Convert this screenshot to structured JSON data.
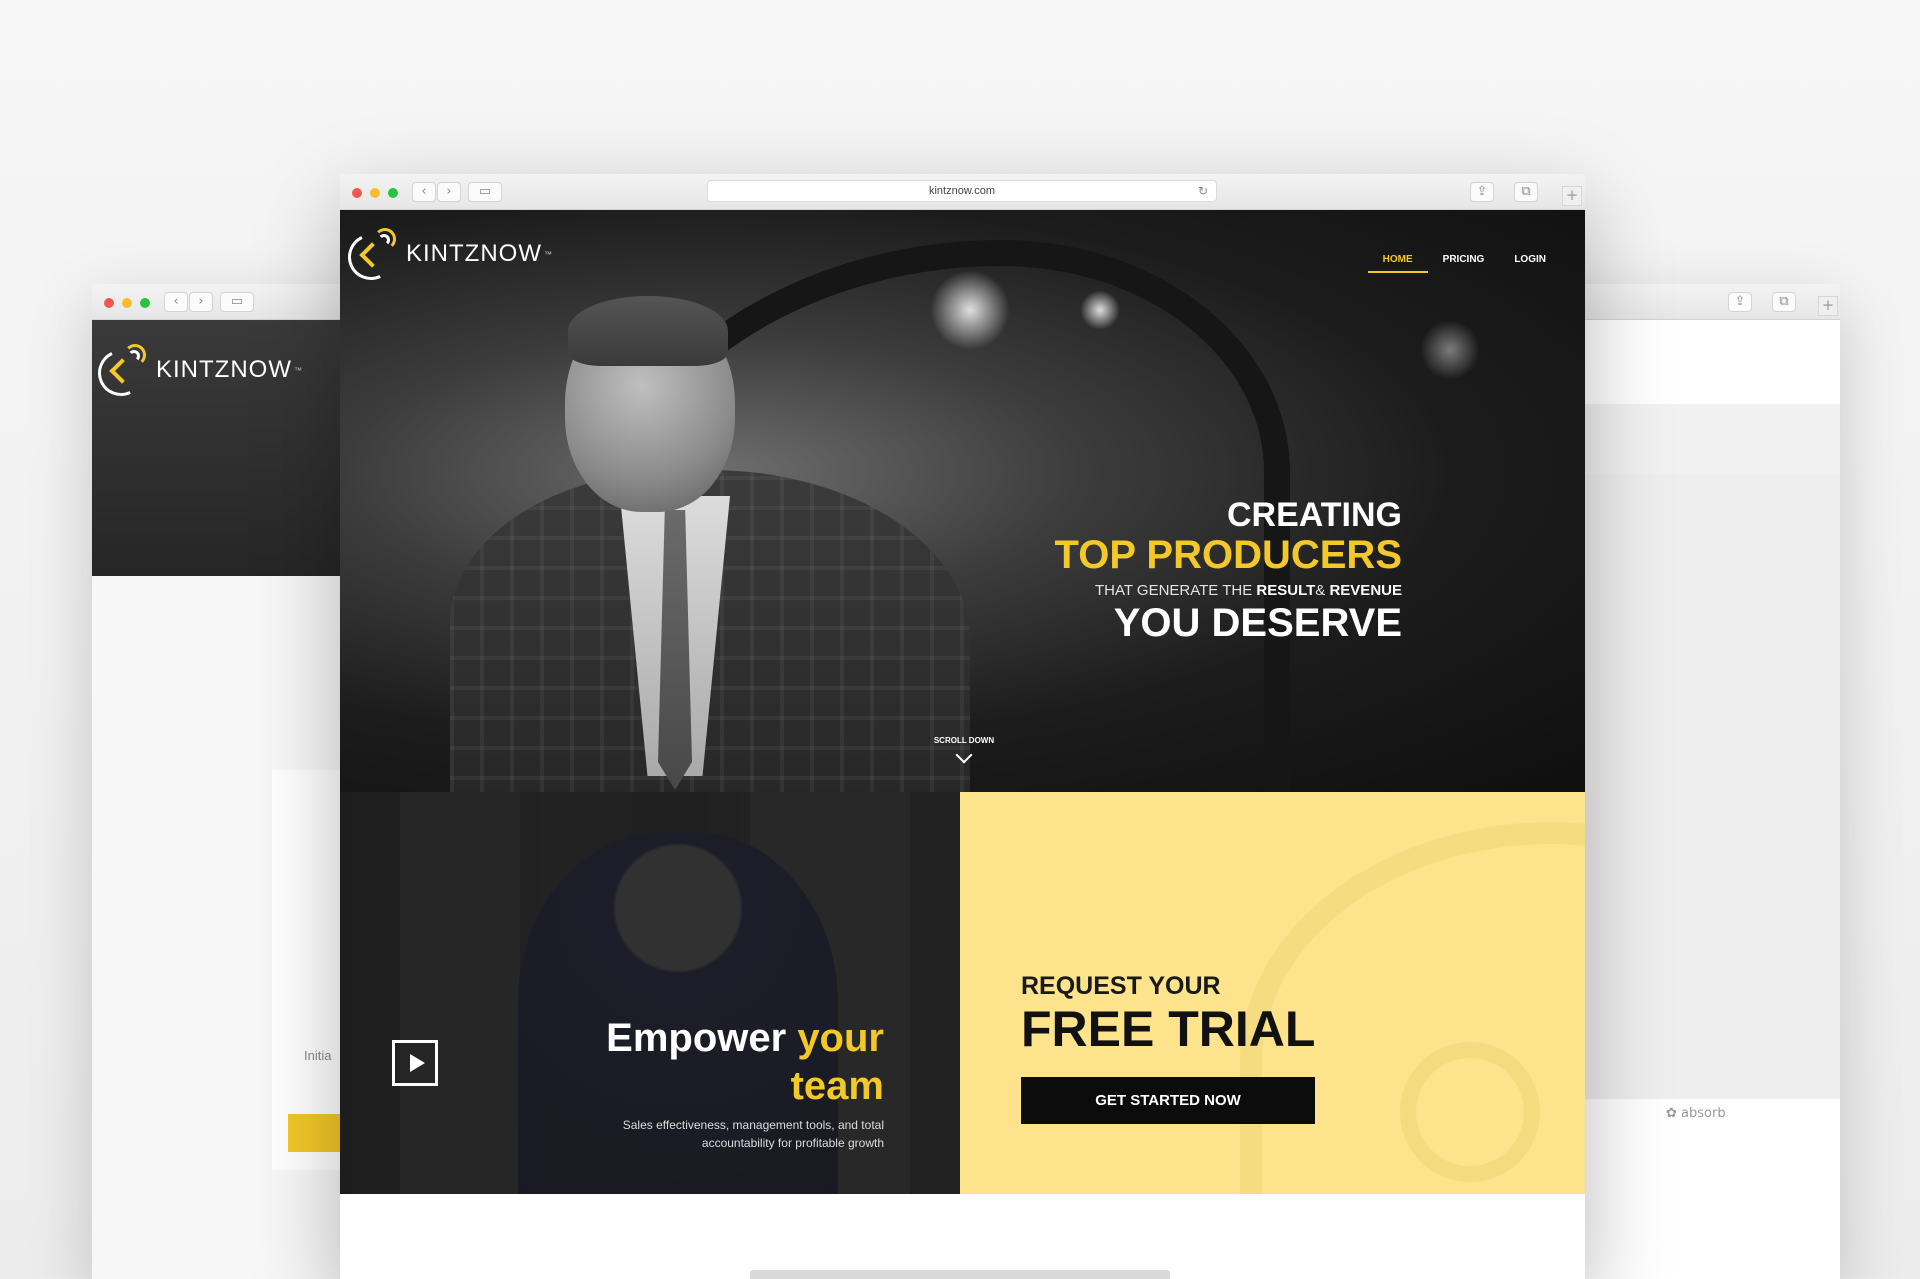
{
  "main_window": {
    "url": "kintznow.com",
    "logo_text": "KINTZNOW",
    "logo_tm": "™",
    "nav": [
      {
        "label": "HOME",
        "active": true
      },
      {
        "label": "PRICING",
        "active": false
      },
      {
        "label": "LOGIN",
        "active": false
      }
    ],
    "hero": {
      "line1": "CREATING",
      "line2": "TOP PRODUCERS",
      "line3_prefix": "THAT GENERATE THE",
      "line3_bold1": "RESULT",
      "line3_mid": "&",
      "line3_bold2": "REVENUE",
      "line4": "YOU DESERVE",
      "scroll_label": "SCROLL DOWN"
    },
    "empower": {
      "title_white": "Empower",
      "title_yellow": "your",
      "title_line2": "team",
      "subtitle": "Sales effectiveness, management tools, and total accountability for profitable growth"
    },
    "trial": {
      "line1": "REQUEST YOUR",
      "line2": "FREE TRIAL",
      "cta_label": "GET STARTED NOW"
    }
  },
  "left_window": {
    "logo_text": "KINTZNOW",
    "logo_tm": "™",
    "form_label": "Initia"
  },
  "right_window": {
    "footer_brand": "absorb"
  },
  "icons": {
    "back": "‹",
    "forward": "›",
    "sidebar": "▭",
    "reload": "↻",
    "share": "⇪",
    "tabs": "⧉",
    "new_tab": "+"
  },
  "colors": {
    "accent_yellow": "#f3c829",
    "trial_yellow": "#fde48c",
    "dark": "#0c0c0c"
  }
}
